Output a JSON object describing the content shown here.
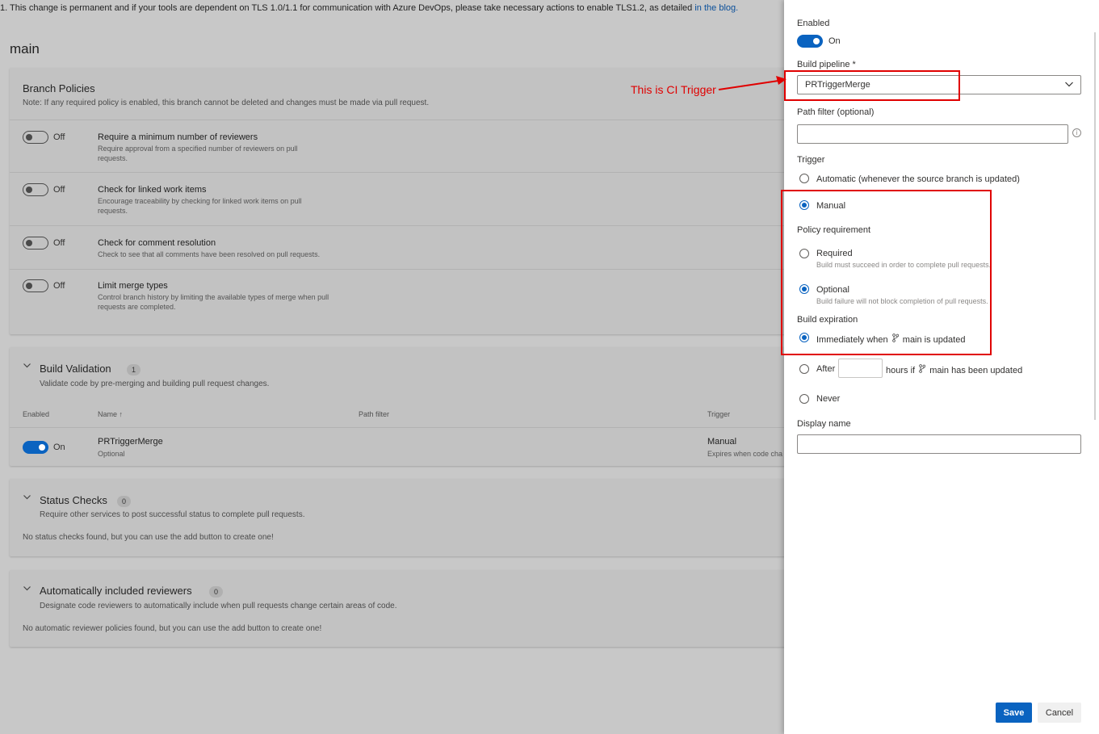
{
  "notice": {
    "text": "1. This change is permanent and if your tools are dependent on TLS 1.0/1.1 for communication with Azure DevOps, please take necessary actions to enable TLS1.2, as detailed ",
    "link": "in the blog."
  },
  "branch": {
    "name": "main"
  },
  "branch_policies": {
    "title": "Branch Policies",
    "note": "Note: If any required policy is enabled, this branch cannot be deleted and changes must be made via pull request.",
    "items": [
      {
        "state": "Off",
        "title": "Require a minimum number of reviewers",
        "desc": "Require approval from a specified number of reviewers on pull requests."
      },
      {
        "state": "Off",
        "title": "Check for linked work items",
        "desc": "Encourage traceability by checking for linked work items on pull requests."
      },
      {
        "state": "Off",
        "title": "Check for comment resolution",
        "desc": "Check to see that all comments have been resolved on pull requests."
      },
      {
        "state": "Off",
        "title": "Limit merge types",
        "desc": "Control branch history by limiting the available types of merge when pull requests are completed."
      }
    ]
  },
  "build_validation": {
    "title": "Build Validation",
    "count": "1",
    "desc": "Validate code by pre-merging and building pull request changes.",
    "columns": {
      "enabled": "Enabled",
      "name": "Name",
      "sort_icon": "↑",
      "path_filter": "Path filter",
      "trigger": "Trigger"
    },
    "rows": [
      {
        "state": "On",
        "name": "PRTriggerMerge",
        "requirement": "Optional",
        "trigger": "Manual",
        "trigger_sub": "Expires when code cha"
      }
    ]
  },
  "status_checks": {
    "title": "Status Checks",
    "count": "0",
    "desc": "Require other services to post successful status to complete pull requests.",
    "empty": "No status checks found, but you can use the add button to create one!"
  },
  "auto_reviewers": {
    "title": "Automatically included reviewers",
    "count": "0",
    "desc": "Designate code reviewers to automatically include when pull requests change certain areas of code.",
    "empty": "No automatic reviewer policies found, but you can use the add button to create one!"
  },
  "panel": {
    "enabled_label": "Enabled",
    "enabled_state": "On",
    "build_pipeline_label": "Build pipeline *",
    "build_pipeline_value": "PRTriggerMerge",
    "path_filter_label": "Path filter (optional)",
    "path_filter_value": "",
    "trigger_label": "Trigger",
    "trigger_automatic": "Automatic (whenever the source branch is updated)",
    "trigger_manual": "Manual",
    "policy_label": "Policy requirement",
    "required_label": "Required",
    "required_desc": "Build must succeed in order to complete pull requests.",
    "optional_label": "Optional",
    "optional_desc": "Build failure will not block completion of pull requests.",
    "expiration_label": "Build expiration",
    "exp_immediate_pre": "Immediately when",
    "exp_immediate_post": "main is updated",
    "exp_after": "After",
    "exp_after_value": "",
    "exp_hours_pre": "hours if",
    "exp_hours_post": "main has been updated",
    "exp_never": "Never",
    "display_name_label": "Display name",
    "display_name_value": "",
    "save": "Save",
    "cancel": "Cancel"
  },
  "annotation": {
    "text": "This is CI Trigger"
  },
  "icons": {
    "branch": "branch-icon",
    "chevron": "chevron-down-icon",
    "info": "info-icon"
  },
  "colors": {
    "accent": "#0a63c0",
    "annotation": "#e00000"
  }
}
